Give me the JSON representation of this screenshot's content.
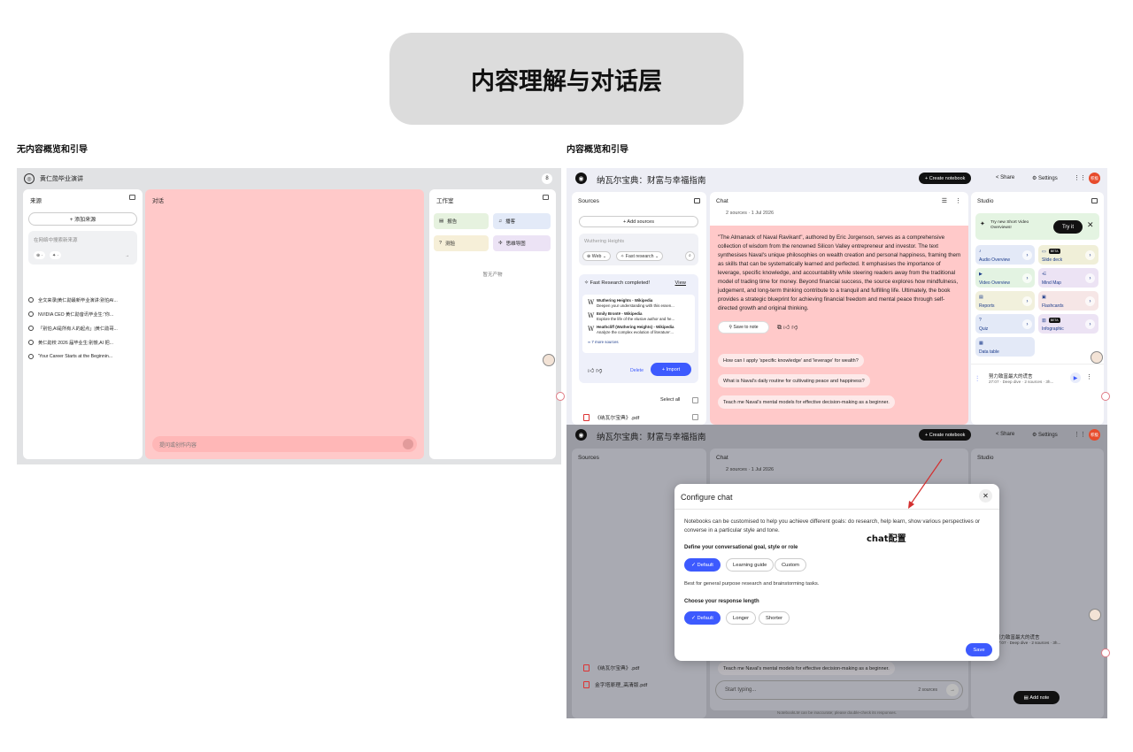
{
  "title": "内容理解与对话层",
  "left_section_label": "无内容概览和引导",
  "right_section_label": "内容概览和引导",
  "left_app": {
    "notebook_title": "黄仁勋毕业演讲",
    "avatar_letter": "8",
    "sources": {
      "header": "来源",
      "add_button": "+ 添加来源",
      "search_placeholder": "在网络中搜索新来源",
      "items": [
        "全文来录|黄仁勋最新毕业演讲:别怕AI...",
        "NVIDIA CEO 黄仁勋音讯毕业生:“你...",
        "「别怕,AI是所有人的起点」|黄仁勋哥...",
        "黄仁勋校 2026 届毕业生:别慌,AI 把...",
        "'Your Career Starts at the Beginnin..."
      ]
    },
    "chat": {
      "header": "对话",
      "input_placeholder": "提问或创作内容"
    },
    "studio": {
      "header": "工作室",
      "buttons": [
        "报告",
        "播客",
        "测验",
        "思维导图"
      ],
      "empty": "暂无产物"
    }
  },
  "right_app_top": {
    "notebook_title": "纳瓦尔宝典：财富与幸福指南",
    "create_notebook": "+ Create notebook",
    "share": "Share",
    "settings": "Settings",
    "user_avatar": "积极",
    "sources": {
      "header": "Sources",
      "add_button": "+ Add sources",
      "search_placeholder": "Wuthering Heights",
      "chip_web": "Web",
      "chip_research": "Fast research",
      "fast_research": "Fast Research completed!",
      "view": "View",
      "results": [
        {
          "title": "Wuthering Heights - Wikipedia",
          "desc": "Deepen your understanding with this essen..."
        },
        {
          "title": "Emily Brontë - Wikipedia",
          "desc": "Explore the life of the elusive author and he..."
        },
        {
          "title": "Heathcliff (Wuthering Heights) - Wikipedia",
          "desc": "Analyze the complex evolution of literature'..."
        }
      ],
      "more_sources": "7 more sources",
      "delete": "Delete",
      "import": "+ Import",
      "select_all": "Select all",
      "files": [
        "《纳瓦尔宝典》.pdf"
      ]
    },
    "chat": {
      "header": "Chat",
      "meta": "2 sources · 1 Jul 2026",
      "answer": "\"The Almanack of Naval Ravikant\", authored by Eric Jorgenson, serves as a comprehensive collection of wisdom from the renowned Silicon Valley entrepreneur and investor. The text synthesises Naval's unique philosophies on wealth creation and personal happiness, framing them as skills that can be systematically learned and perfected. It emphasises the importance of leverage, specific knowledge, and accountability while steering readers away from the traditional model of trading time for money. Beyond financial success, the source explores how mindfulness, judgement, and long-term thinking contribute to a tranquil and fulfilling life. Ultimately, the book provides a strategic blueprint for achieving financial freedom and mental peace through self-directed growth and original thinking.",
      "save_to_note": "Save to note",
      "suggestions": [
        "How can I apply 'specific knowledge' and 'leverage' for wealth?",
        "What is Naval's daily routine for cultivating peace and happiness?",
        "Teach me Naval's mental models for effective decision-making as a beginner."
      ]
    },
    "studio": {
      "header": "Studio",
      "promo": "Try new Short Video Overviews!",
      "try_it": "Try it",
      "cards": [
        "Audio Overview",
        "Slide deck",
        "Video Overview",
        "Mind Map",
        "Reports",
        "Flashcards",
        "Quiz",
        "Infographic",
        "Data table"
      ],
      "beta": "BETA",
      "artifact_title": "努力致富最大的谎言",
      "artifact_meta": "27:07 · Deep dive · 2 sources · 3h..."
    }
  },
  "right_app_bottom": {
    "notebook_title": "纳瓦尔宝典：财富与幸福指南",
    "create_notebook": "+ Create notebook",
    "share": "Share",
    "settings": "Settings",
    "user_avatar": "积极",
    "files": [
      "《纳瓦尔宝典》.pdf",
      "金字塔原理_高清版.pdf"
    ],
    "chat_input_placeholder": "Start typing...",
    "chat_sources_count": "2 sources",
    "add_note": "Add note",
    "footer": "NotebookLM can be inaccurate; please double-check its responses.",
    "suggestion_visible": "Teach me Naval's mental models for effective decision-making as a beginner.",
    "artifact_title": "努力致富最大的谎言",
    "artifact_meta": "27:07 · Deep dive · 2 sources · 3h...",
    "dialog": {
      "title": "Configure chat",
      "description": "Notebooks can be customised to help you achieve different goals: do research, help learn, show various perspectives or converse in a particular style and tone.",
      "goal_heading": "Define your conversational goal, style or role",
      "goal_options": [
        "Default",
        "Learning guide",
        "Custom"
      ],
      "goal_note": "Best for general purpose research and brainstorming tasks.",
      "length_heading": "Choose your response length",
      "length_options": [
        "Default",
        "Longer",
        "Shorter"
      ],
      "save": "Save"
    },
    "annotation": "chat配置"
  },
  "colors": {
    "highlight_pink": "#ffc9c9",
    "accent_blue": "#3d5afe",
    "title_bg": "#dcdcdc",
    "annotation_red": "#d32f2f"
  }
}
